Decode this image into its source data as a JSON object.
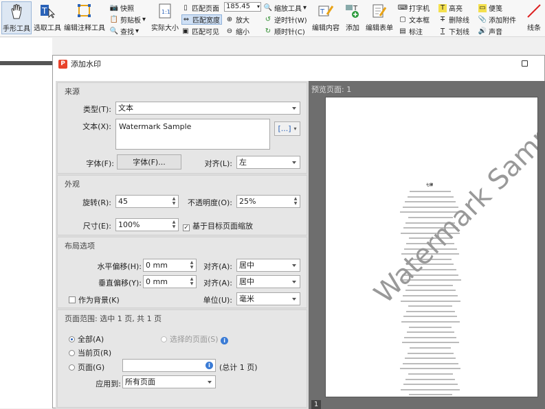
{
  "toolbar": {
    "hand_tool": "手形工具",
    "select_tool": "选取工具",
    "edit_annotation": "编辑注释工具",
    "snapshot": "快照",
    "clipboard": "剪贴板",
    "find": "查找",
    "actual_size": "实际大小",
    "fit_page": "匹配页面",
    "fit_width": "匹配宽度",
    "fit_visible": "匹配可见",
    "zoom_value": "185.45",
    "zoom_tool": "缩放工具",
    "zoom_in": "放大",
    "zoom_out": "缩小",
    "rotate_left": "逆时针(W)",
    "rotate_right": "顺时针(C)",
    "edit_content": "编辑内容",
    "add": "添加",
    "edit_form": "编辑表单",
    "typewriter": "打字机",
    "textbox": "文本框",
    "callout": "标注",
    "highlight": "高亮",
    "strikethrough": "删除线",
    "underline": "下划线",
    "note": "便笺",
    "attach_file": "添加附件",
    "sound": "声音",
    "line": "线条"
  },
  "dialog": {
    "title": "添加水印",
    "source": {
      "title": "来源",
      "type_label": "类型(T):",
      "type_value": "文本",
      "text_label": "文本(X):",
      "text_value": "Watermark Sample",
      "insert_button": "[...]",
      "font_label": "字体(F):",
      "font_button": "字体(F)...",
      "align_label": "对齐(L):",
      "align_value": "左"
    },
    "appearance": {
      "title": "外观",
      "rotation_label": "旋转(R):",
      "rotation_value": "45",
      "opacity_label": "不透明度(O):",
      "opacity_value": "25%",
      "size_label": "尺寸(E):",
      "size_value": "100%",
      "scale_relative_label": "基于目标页面缩放"
    },
    "layout": {
      "title": "布局选项",
      "h_offset_label": "水平偏移(H):",
      "h_offset_value": "0 mm",
      "h_align_label": "对齐(A):",
      "h_align_value": "居中",
      "v_offset_label": "垂直偏移(Y):",
      "v_offset_value": "0 mm",
      "v_align_label": "对齐(A):",
      "v_align_value": "居中",
      "background_label": "作为背景(K)",
      "unit_label": "单位(U):",
      "unit_value": "毫米"
    },
    "page_range": {
      "title": "页面范围: 选中 1 页, 共 1 页",
      "all_label": "全部(A)",
      "selected_label": "选择的页面(S)",
      "current_label": "当前页(R)",
      "pages_label": "页面(G)",
      "pages_value": "",
      "total_label": "(总计 1 页)",
      "apply_to_label": "应用到:",
      "apply_to_value": "所有页面"
    },
    "preview": {
      "label": "预览页面: 1",
      "doc_title": "七律",
      "watermark": "Watermark Sample",
      "page_number": "1"
    }
  }
}
